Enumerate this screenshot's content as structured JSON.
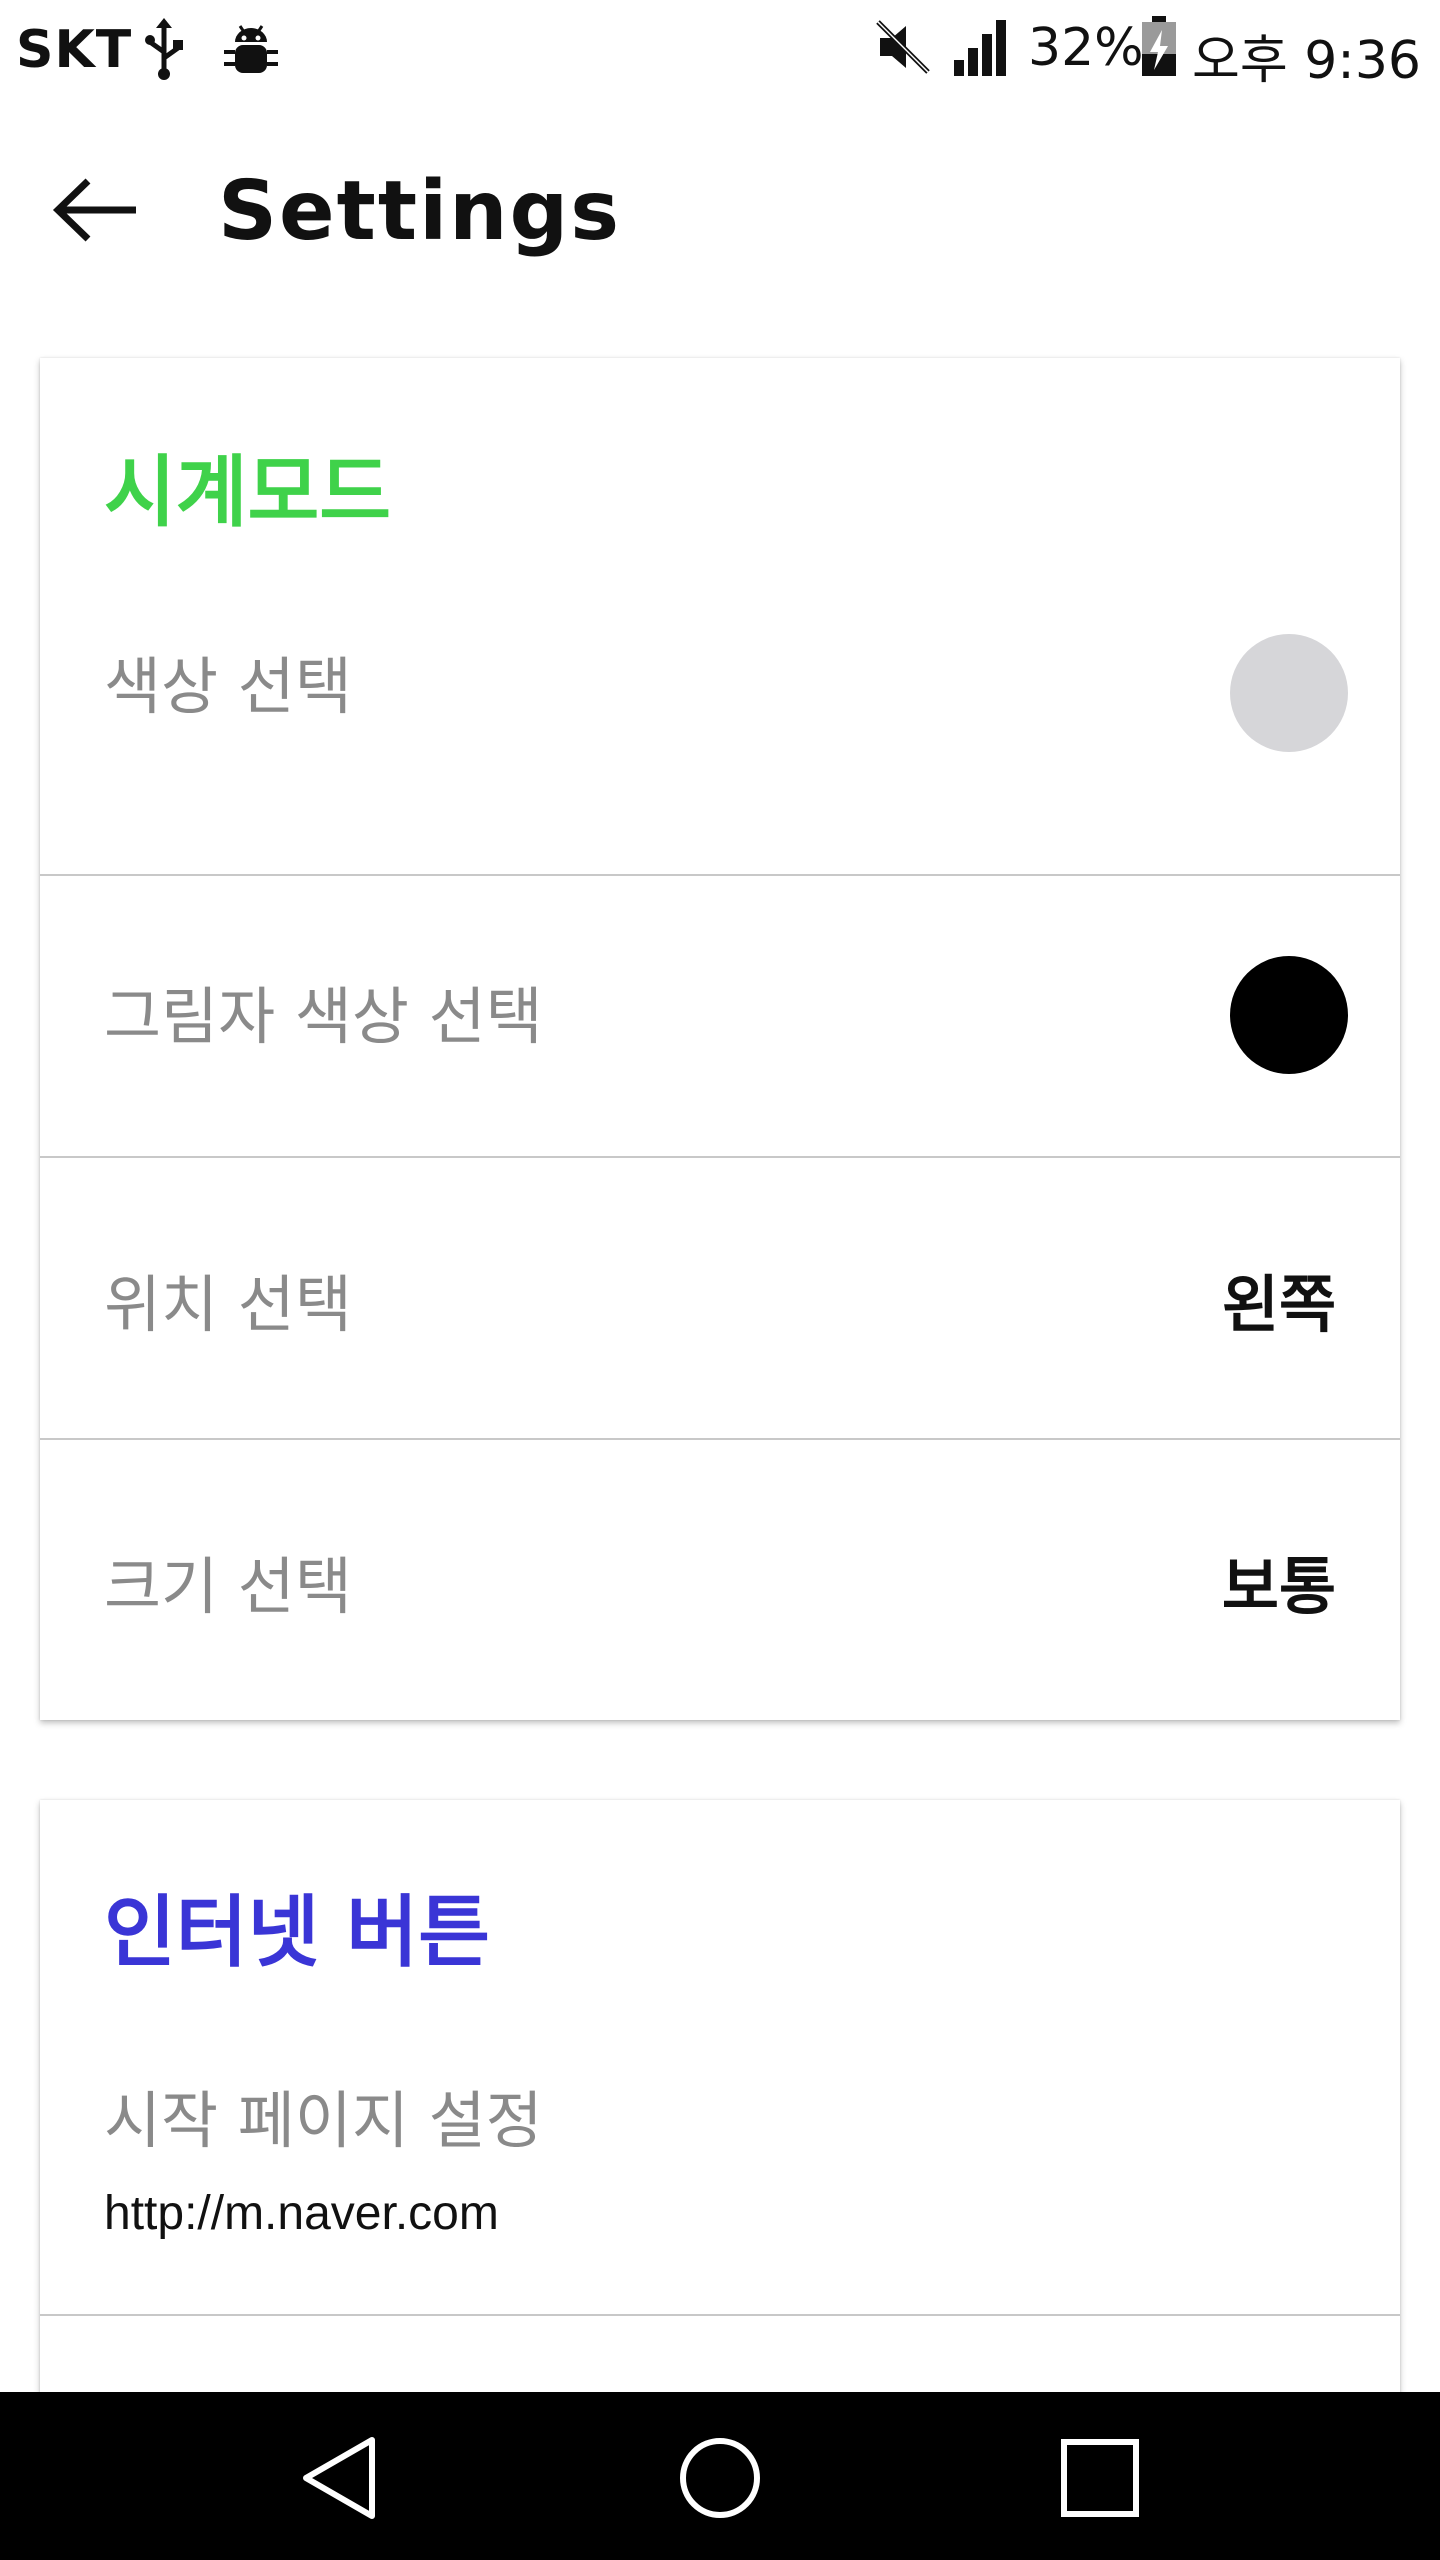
{
  "status_bar": {
    "carrier": "SKT",
    "battery_percent": "32%",
    "time": "오후 9:36",
    "icons": [
      "usb-icon",
      "android-debug-icon",
      "mute-icon",
      "signal-icon",
      "battery-charging-icon"
    ]
  },
  "app_bar": {
    "title": "Settings",
    "back_icon": "arrow-left-icon"
  },
  "clock_mode": {
    "title": "시계모드",
    "title_color": "#3fd24a",
    "items": [
      {
        "label": "색상 선택",
        "swatch_color": "#d6d6d9"
      },
      {
        "label": "그림자 색상 선택",
        "swatch_color": "#000000"
      },
      {
        "label": "위치 선택",
        "value": "왼쪽"
      },
      {
        "label": "크기 선택",
        "value": "보통"
      }
    ]
  },
  "internet_button": {
    "title": "인터넷 버튼",
    "title_color": "#3a35d6",
    "items": [
      {
        "label": "시작 페이지 설정",
        "value": "http://m.naver.com"
      }
    ]
  },
  "nav_bar": {
    "icons": [
      "nav-back-icon",
      "nav-home-icon",
      "nav-recent-icon"
    ]
  }
}
